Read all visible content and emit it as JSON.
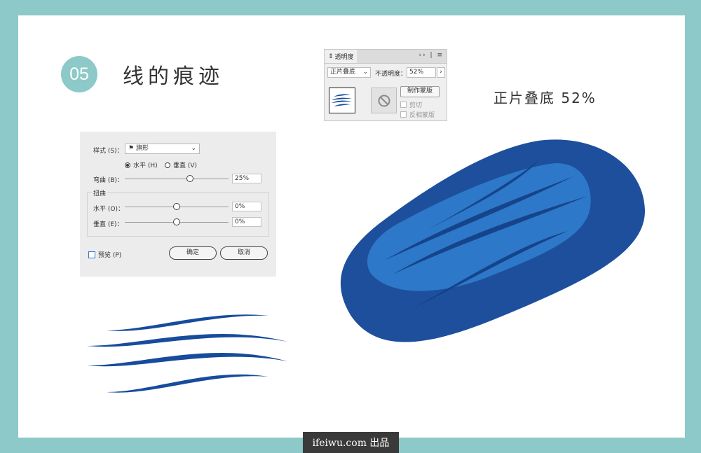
{
  "step": {
    "number": "05",
    "title": "线的痕迹"
  },
  "transparency_panel": {
    "tab_label": "透明度",
    "tab_icon": "double-chevron-updown-icon",
    "menu_icons": "›› | ≡",
    "blend_mode": "正片叠底",
    "opacity_label": "不透明度：",
    "opacity_value": "52%",
    "opacity_button": "›",
    "make_mask_button": "制作蒙版",
    "clip_label": "剪切",
    "invert_mask_label": "反相蒙版"
  },
  "blend_caption": "正片叠底 52%",
  "warp_dialog": {
    "style_label": "样式 (S)：",
    "style_value": "旗形",
    "style_icon": "flag-icon",
    "horizontal_radio": "水平 (H)",
    "vertical_radio": "垂直 (V)",
    "orientation_selected": "horizontal",
    "bend_label": "弯曲 (B)：",
    "bend_value": "25%",
    "bend_level": 0.625,
    "distortion_group": "扭曲",
    "dist_h_label": "水平 (O)：",
    "dist_h_value": "0%",
    "dist_h_level": 0.5,
    "dist_v_label": "垂直 (E)：",
    "dist_v_value": "0%",
    "dist_v_level": 0.5,
    "preview_label": "预览 (P)",
    "ok_button": "确定",
    "cancel_button": "取消"
  },
  "colors": {
    "frame": "#8cc9c8",
    "dark_blue": "#1d4f9c",
    "light_blue": "#2d78c8",
    "stroke_blue": "#174b9c"
  },
  "footer": {
    "brand": "ifeiwu.com 出品"
  }
}
